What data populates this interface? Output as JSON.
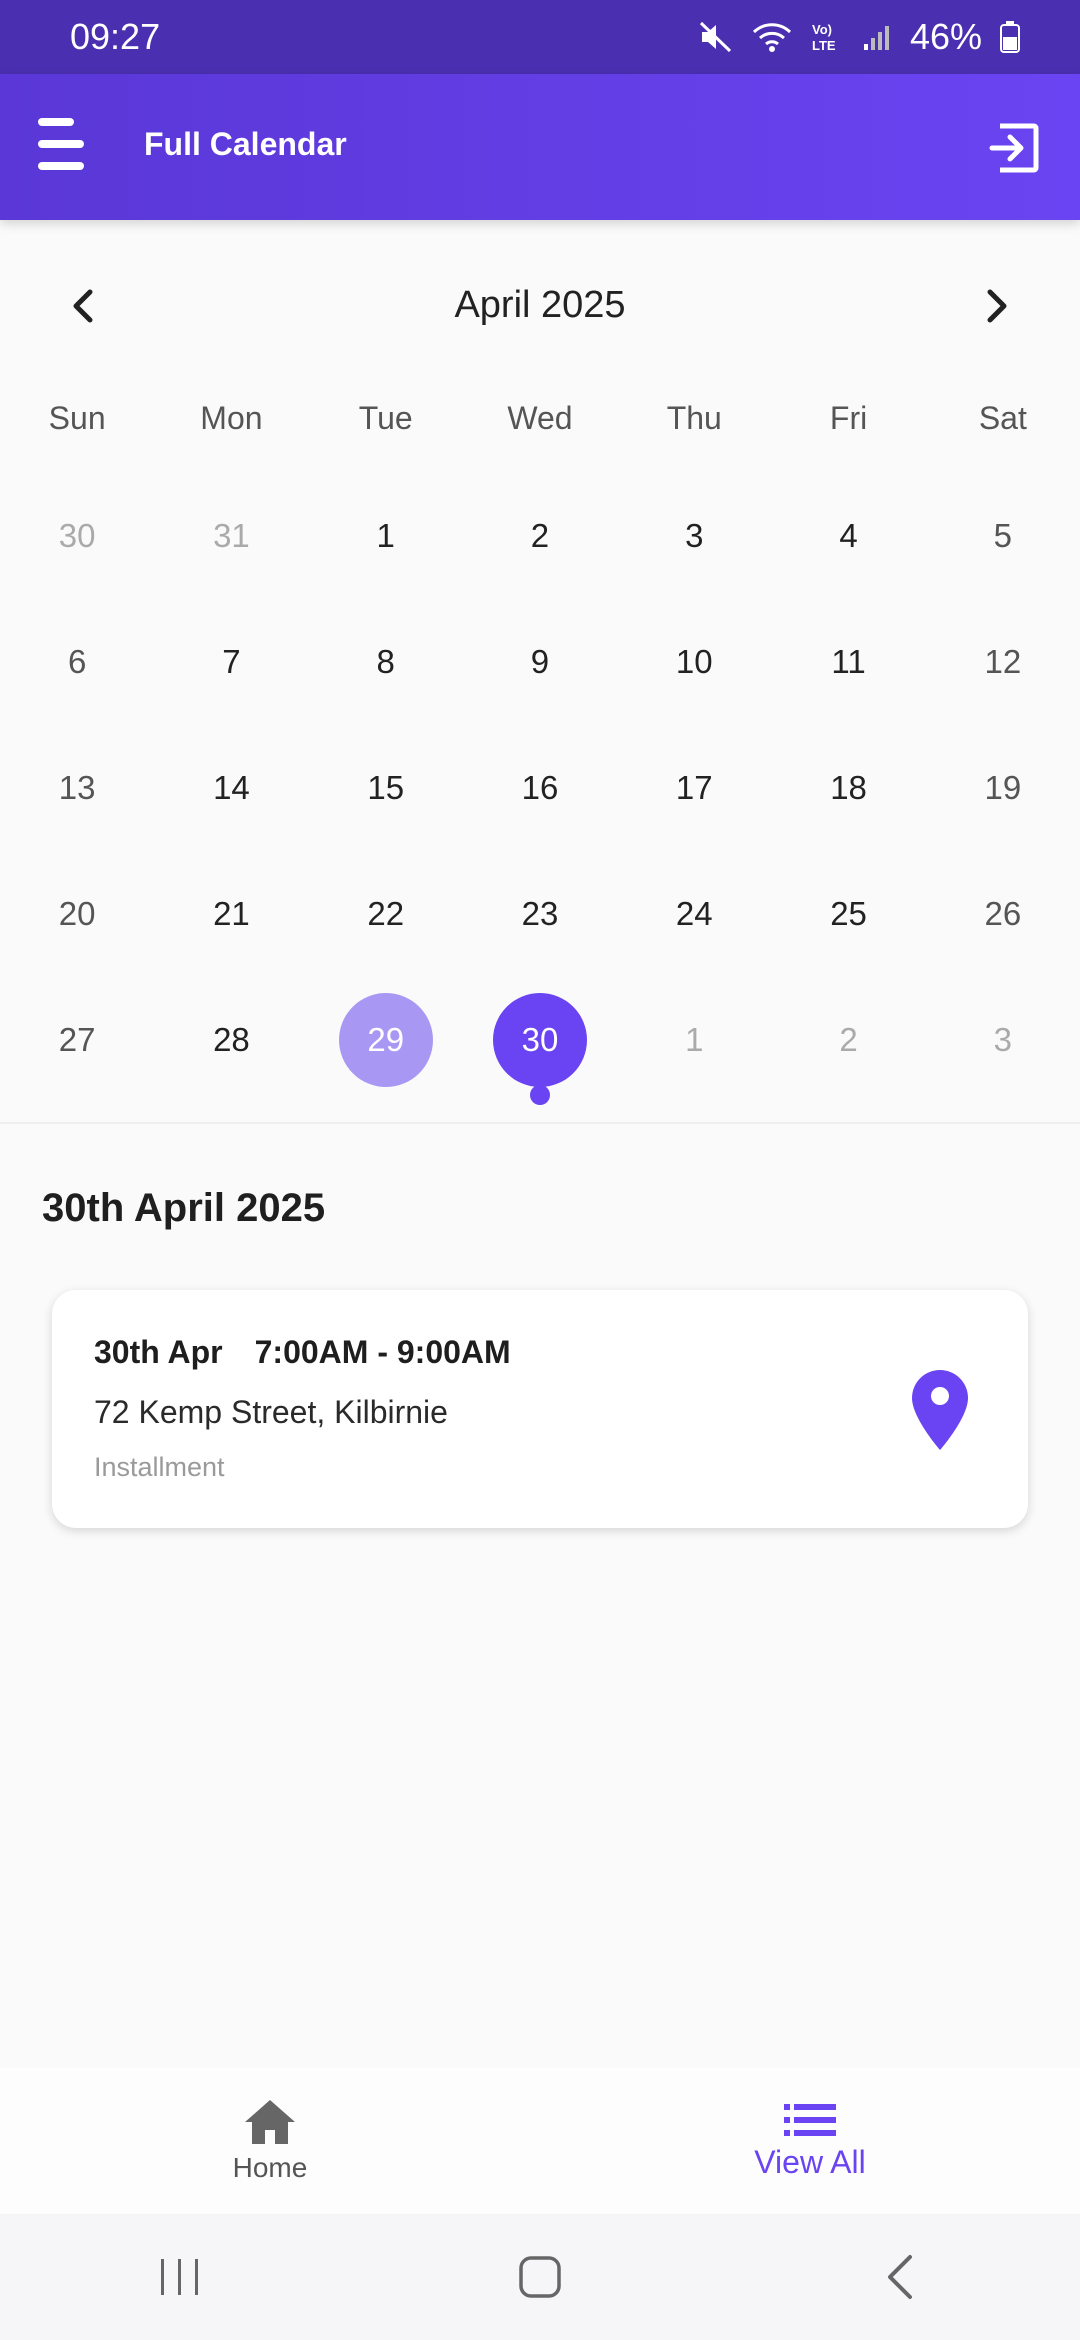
{
  "status_bar": {
    "time": "09:27",
    "battery": "46%"
  },
  "app_bar": {
    "title": "Full Calendar"
  },
  "calendar": {
    "month_label": "April 2025",
    "weekdays": [
      "Sun",
      "Mon",
      "Tue",
      "Wed",
      "Thu",
      "Fri",
      "Sat"
    ],
    "days": [
      {
        "label": "30",
        "muted": true
      },
      {
        "label": "31",
        "muted": true
      },
      {
        "label": "1"
      },
      {
        "label": "2"
      },
      {
        "label": "3"
      },
      {
        "label": "4"
      },
      {
        "label": "5",
        "weekend": true
      },
      {
        "label": "6",
        "weekend": true
      },
      {
        "label": "7"
      },
      {
        "label": "8"
      },
      {
        "label": "9"
      },
      {
        "label": "10"
      },
      {
        "label": "11"
      },
      {
        "label": "12",
        "weekend": true
      },
      {
        "label": "13",
        "weekend": true
      },
      {
        "label": "14"
      },
      {
        "label": "15"
      },
      {
        "label": "16"
      },
      {
        "label": "17"
      },
      {
        "label": "18"
      },
      {
        "label": "19",
        "weekend": true
      },
      {
        "label": "20",
        "weekend": true
      },
      {
        "label": "21"
      },
      {
        "label": "22"
      },
      {
        "label": "23"
      },
      {
        "label": "24"
      },
      {
        "label": "25"
      },
      {
        "label": "26",
        "weekend": true
      },
      {
        "label": "27",
        "weekend": true
      },
      {
        "label": "28"
      },
      {
        "label": "29",
        "state": "today"
      },
      {
        "label": "30",
        "state": "selected",
        "has_event": true
      },
      {
        "label": "1",
        "muted": true
      },
      {
        "label": "2",
        "muted": true
      },
      {
        "label": "3",
        "muted": true
      }
    ],
    "accent_color": "#6a44f2",
    "today_color": "#a898f4"
  },
  "selected_date_heading": "30th April 2025",
  "event": {
    "date": "30th Apr",
    "time": "7:00AM - 9:00AM",
    "address": "72 Kemp Street, Kilbirnie",
    "type": "Installment"
  },
  "bottom_nav": {
    "home_label": "Home",
    "view_all_label": "View All"
  }
}
